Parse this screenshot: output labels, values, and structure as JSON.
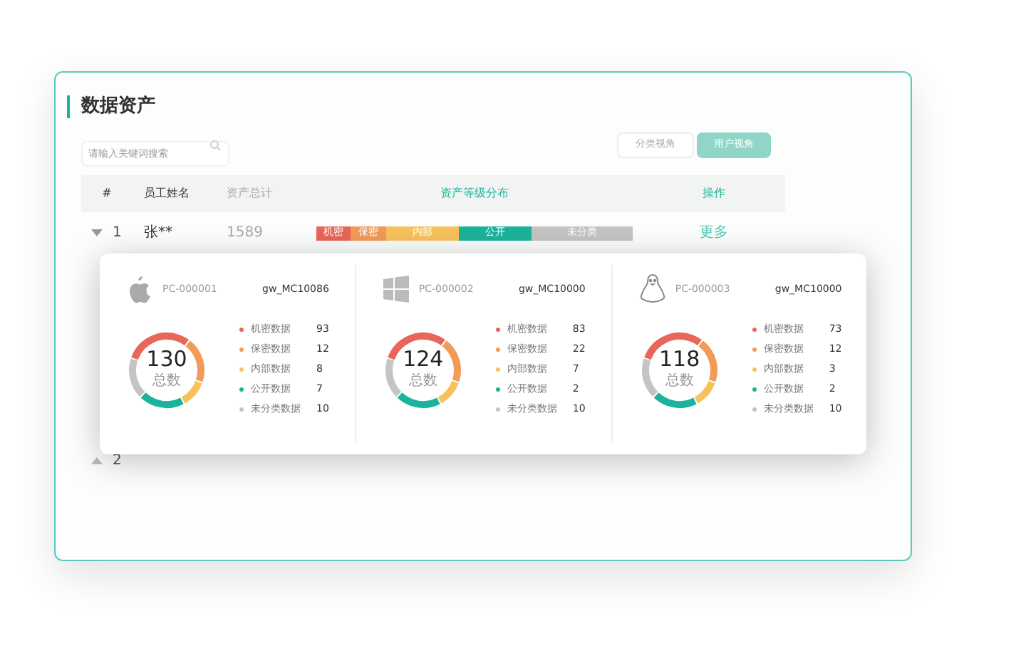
{
  "title": "数据资产",
  "search": {
    "placeholder": "请输入关键词搜索"
  },
  "view_buttons": [
    {
      "label": "分类视角",
      "selected": false
    },
    {
      "label": "用户视角",
      "selected": true
    }
  ],
  "table": {
    "columns": [
      "#",
      "员工姓名",
      "资产总计",
      "资产等级分布",
      "操作"
    ],
    "rows": [
      {
        "expanded": true,
        "index": "1",
        "name": "张**",
        "total": "1589",
        "action": "更多",
        "segments": [
          {
            "label": "机密",
            "color": "#e8665a"
          },
          {
            "label": "保密",
            "color": "#f29a58"
          },
          {
            "label": "内部",
            "color": "#f7c25c"
          },
          {
            "label": "公开",
            "color": "#1bb39a"
          },
          {
            "label": "未分类",
            "color": "#c4c4c4"
          }
        ]
      },
      {
        "expanded": false,
        "index": "2"
      }
    ]
  },
  "devices": [
    {
      "kind": "apple",
      "id": "PC-000001",
      "account": "gw_MC10086",
      "total": "130",
      "total_label": "总数",
      "legend": [
        {
          "label": "机密数据",
          "value": "93",
          "color": "#e8665a"
        },
        {
          "label": "保密数据",
          "value": "12",
          "color": "#f29a58"
        },
        {
          "label": "内部数据",
          "value": "8",
          "color": "#f7c25c"
        },
        {
          "label": "公开数据",
          "value": "7",
          "color": "#1bb39a"
        },
        {
          "label": "未分类数据",
          "value": "10",
          "color": "#c4c4c4"
        }
      ]
    },
    {
      "kind": "windows",
      "id": "PC-000002",
      "account": "gw_MC10000",
      "total": "124",
      "total_label": "总数",
      "legend": [
        {
          "label": "机密数据",
          "value": "83",
          "color": "#e8665a"
        },
        {
          "label": "保密数据",
          "value": "22",
          "color": "#f29a58"
        },
        {
          "label": "内部数据",
          "value": "7",
          "color": "#f7c25c"
        },
        {
          "label": "公开数据",
          "value": "2",
          "color": "#1bb39a"
        },
        {
          "label": "未分类数据",
          "value": "10",
          "color": "#c4c4c4"
        }
      ]
    },
    {
      "kind": "linux",
      "id": "PC-000003",
      "account": "gw_MC10000",
      "total": "118",
      "total_label": "总数",
      "legend": [
        {
          "label": "机密数据",
          "value": "73",
          "color": "#e8665a"
        },
        {
          "label": "保密数据",
          "value": "12",
          "color": "#f29a58"
        },
        {
          "label": "内部数据",
          "value": "3",
          "color": "#f7c25c"
        },
        {
          "label": "公开数据",
          "value": "2",
          "color": "#1bb39a"
        },
        {
          "label": "未分类数据",
          "value": "10",
          "color": "#c4c4c4"
        }
      ]
    }
  ]
}
